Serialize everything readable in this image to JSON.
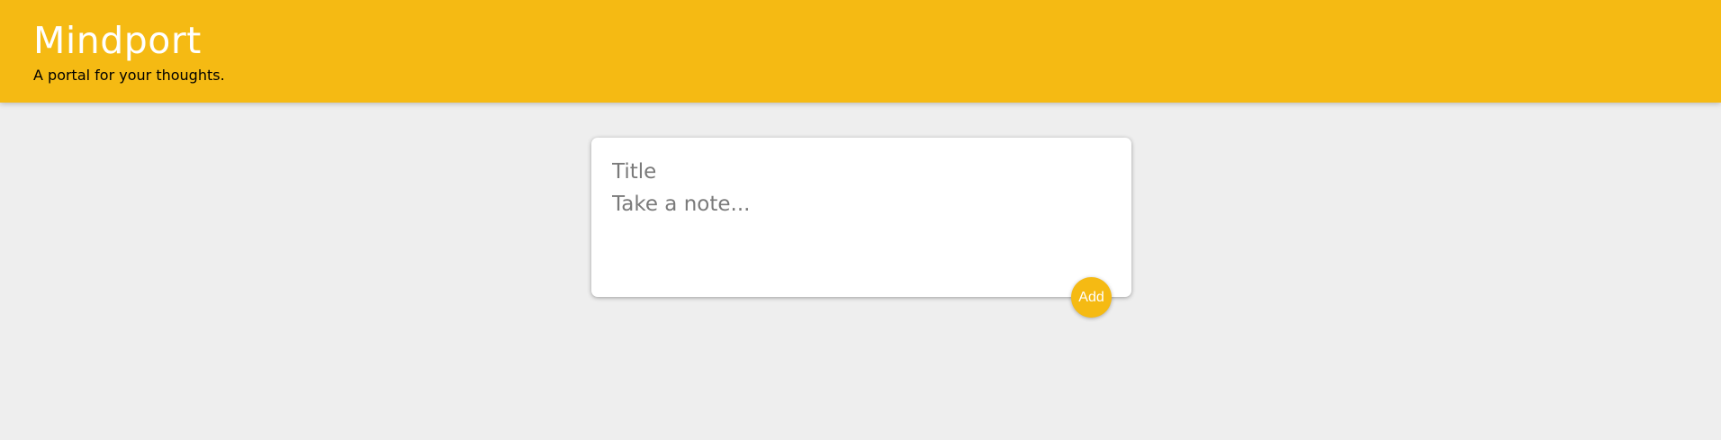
{
  "header": {
    "title": "Mindport",
    "tagline": "A portal for your thoughts."
  },
  "note_form": {
    "title_placeholder": "Title",
    "title_value": "",
    "content_placeholder": "Take a note...",
    "content_value": "",
    "add_label": "Add"
  },
  "colors": {
    "accent": "#f5ba13",
    "background": "#eeeeee",
    "card": "#ffffff"
  }
}
